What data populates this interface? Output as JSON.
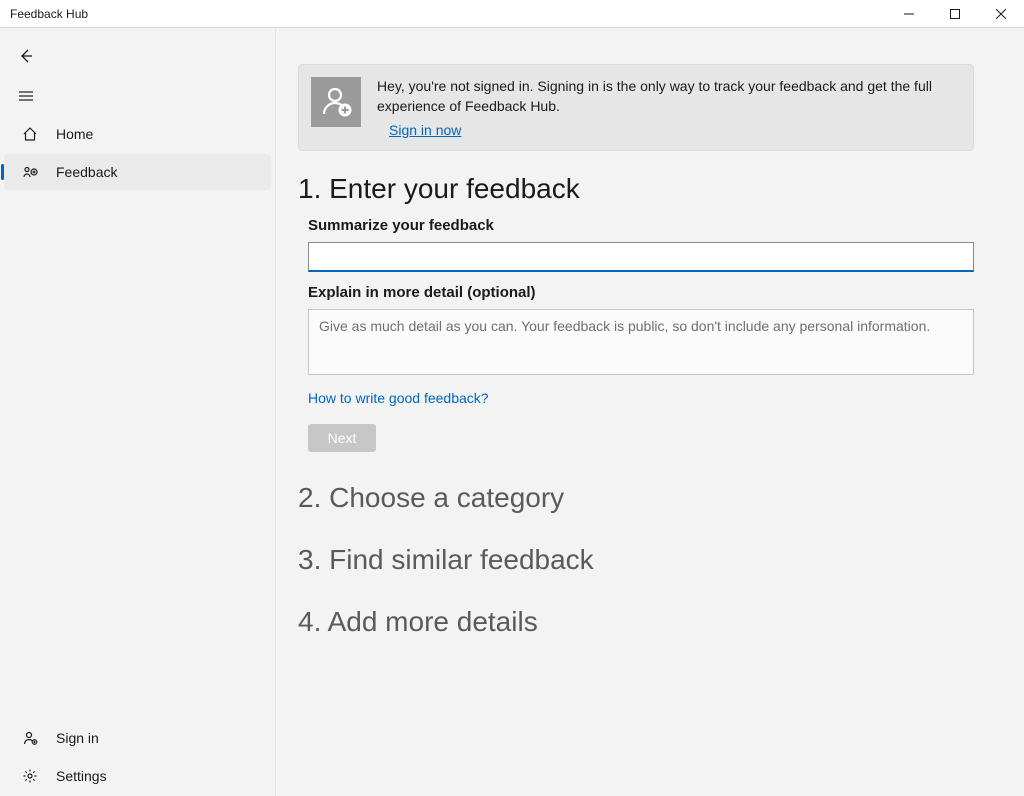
{
  "window": {
    "title": "Feedback Hub"
  },
  "sidebar": {
    "items": [
      {
        "label": "Home"
      },
      {
        "label": "Feedback"
      }
    ],
    "signin_label": "Sign in",
    "settings_label": "Settings"
  },
  "banner": {
    "message": "Hey, you're not signed in. Signing in is the only way to track your feedback and get the full experience of Feedback Hub.",
    "link_label": "Sign in now"
  },
  "steps": {
    "s1": "1. Enter your feedback",
    "s2": "2. Choose a category",
    "s3": "3. Find similar feedback",
    "s4": "4. Add more details"
  },
  "form": {
    "summary_label": "Summarize your feedback",
    "summary_value": "",
    "detail_label": "Explain in more detail (optional)",
    "detail_placeholder": "Give as much detail as you can. Your feedback is public, so don't include any personal information.",
    "help_link": "How to write good feedback?",
    "next_label": "Next"
  }
}
